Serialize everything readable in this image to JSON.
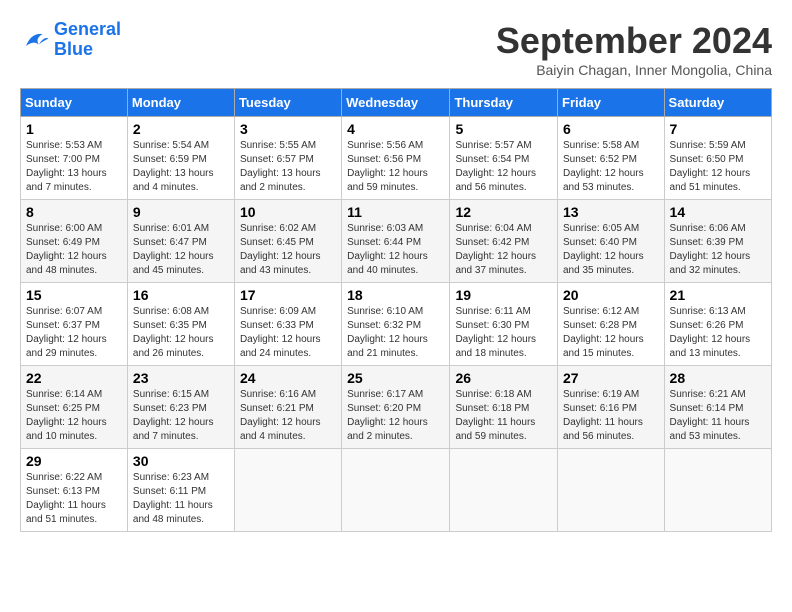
{
  "header": {
    "logo_line1": "General",
    "logo_line2": "Blue",
    "month": "September 2024",
    "location": "Baiyin Chagan, Inner Mongolia, China"
  },
  "days_of_week": [
    "Sunday",
    "Monday",
    "Tuesday",
    "Wednesday",
    "Thursday",
    "Friday",
    "Saturday"
  ],
  "weeks": [
    [
      {
        "day": "1",
        "sunrise": "5:53 AM",
        "sunset": "7:00 PM",
        "daylight": "13 hours and 7 minutes."
      },
      {
        "day": "2",
        "sunrise": "5:54 AM",
        "sunset": "6:59 PM",
        "daylight": "13 hours and 4 minutes."
      },
      {
        "day": "3",
        "sunrise": "5:55 AM",
        "sunset": "6:57 PM",
        "daylight": "13 hours and 2 minutes."
      },
      {
        "day": "4",
        "sunrise": "5:56 AM",
        "sunset": "6:56 PM",
        "daylight": "12 hours and 59 minutes."
      },
      {
        "day": "5",
        "sunrise": "5:57 AM",
        "sunset": "6:54 PM",
        "daylight": "12 hours and 56 minutes."
      },
      {
        "day": "6",
        "sunrise": "5:58 AM",
        "sunset": "6:52 PM",
        "daylight": "12 hours and 53 minutes."
      },
      {
        "day": "7",
        "sunrise": "5:59 AM",
        "sunset": "6:50 PM",
        "daylight": "12 hours and 51 minutes."
      }
    ],
    [
      {
        "day": "8",
        "sunrise": "6:00 AM",
        "sunset": "6:49 PM",
        "daylight": "12 hours and 48 minutes."
      },
      {
        "day": "9",
        "sunrise": "6:01 AM",
        "sunset": "6:47 PM",
        "daylight": "12 hours and 45 minutes."
      },
      {
        "day": "10",
        "sunrise": "6:02 AM",
        "sunset": "6:45 PM",
        "daylight": "12 hours and 43 minutes."
      },
      {
        "day": "11",
        "sunrise": "6:03 AM",
        "sunset": "6:44 PM",
        "daylight": "12 hours and 40 minutes."
      },
      {
        "day": "12",
        "sunrise": "6:04 AM",
        "sunset": "6:42 PM",
        "daylight": "12 hours and 37 minutes."
      },
      {
        "day": "13",
        "sunrise": "6:05 AM",
        "sunset": "6:40 PM",
        "daylight": "12 hours and 35 minutes."
      },
      {
        "day": "14",
        "sunrise": "6:06 AM",
        "sunset": "6:39 PM",
        "daylight": "12 hours and 32 minutes."
      }
    ],
    [
      {
        "day": "15",
        "sunrise": "6:07 AM",
        "sunset": "6:37 PM",
        "daylight": "12 hours and 29 minutes."
      },
      {
        "day": "16",
        "sunrise": "6:08 AM",
        "sunset": "6:35 PM",
        "daylight": "12 hours and 26 minutes."
      },
      {
        "day": "17",
        "sunrise": "6:09 AM",
        "sunset": "6:33 PM",
        "daylight": "12 hours and 24 minutes."
      },
      {
        "day": "18",
        "sunrise": "6:10 AM",
        "sunset": "6:32 PM",
        "daylight": "12 hours and 21 minutes."
      },
      {
        "day": "19",
        "sunrise": "6:11 AM",
        "sunset": "6:30 PM",
        "daylight": "12 hours and 18 minutes."
      },
      {
        "day": "20",
        "sunrise": "6:12 AM",
        "sunset": "6:28 PM",
        "daylight": "12 hours and 15 minutes."
      },
      {
        "day": "21",
        "sunrise": "6:13 AM",
        "sunset": "6:26 PM",
        "daylight": "12 hours and 13 minutes."
      }
    ],
    [
      {
        "day": "22",
        "sunrise": "6:14 AM",
        "sunset": "6:25 PM",
        "daylight": "12 hours and 10 minutes."
      },
      {
        "day": "23",
        "sunrise": "6:15 AM",
        "sunset": "6:23 PM",
        "daylight": "12 hours and 7 minutes."
      },
      {
        "day": "24",
        "sunrise": "6:16 AM",
        "sunset": "6:21 PM",
        "daylight": "12 hours and 4 minutes."
      },
      {
        "day": "25",
        "sunrise": "6:17 AM",
        "sunset": "6:20 PM",
        "daylight": "12 hours and 2 minutes."
      },
      {
        "day": "26",
        "sunrise": "6:18 AM",
        "sunset": "6:18 PM",
        "daylight": "11 hours and 59 minutes."
      },
      {
        "day": "27",
        "sunrise": "6:19 AM",
        "sunset": "6:16 PM",
        "daylight": "11 hours and 56 minutes."
      },
      {
        "day": "28",
        "sunrise": "6:21 AM",
        "sunset": "6:14 PM",
        "daylight": "11 hours and 53 minutes."
      }
    ],
    [
      {
        "day": "29",
        "sunrise": "6:22 AM",
        "sunset": "6:13 PM",
        "daylight": "11 hours and 51 minutes."
      },
      {
        "day": "30",
        "sunrise": "6:23 AM",
        "sunset": "6:11 PM",
        "daylight": "11 hours and 48 minutes."
      },
      null,
      null,
      null,
      null,
      null
    ]
  ]
}
